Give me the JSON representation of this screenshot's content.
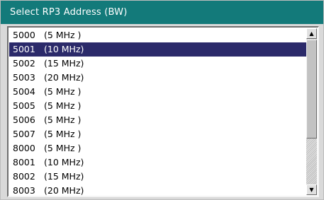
{
  "dialog": {
    "title": "Select RP3 Address  (BW)"
  },
  "list": {
    "items": [
      {
        "address": "5000",
        "bandwidth": "(5 MHz )"
      },
      {
        "address": "5001",
        "bandwidth": "(10 MHz)",
        "selected": true
      },
      {
        "address": "5002",
        "bandwidth": "(15 MHz)"
      },
      {
        "address": "5003",
        "bandwidth": "(20 MHz)"
      },
      {
        "address": "5004",
        "bandwidth": "(5 MHz )"
      },
      {
        "address": "5005",
        "bandwidth": "(5 MHz )"
      },
      {
        "address": "5006",
        "bandwidth": "(5 MHz )"
      },
      {
        "address": "5007",
        "bandwidth": "(5 MHz )"
      },
      {
        "address": "8000",
        "bandwidth": "(5 MHz )"
      },
      {
        "address": "8001",
        "bandwidth": "(10 MHz)"
      },
      {
        "address": "8002",
        "bandwidth": "(15 MHz)"
      },
      {
        "address": "8003",
        "bandwidth": "(20 MHz)"
      }
    ]
  },
  "scrollbar": {
    "up_icon": "▲",
    "down_icon": "▼"
  },
  "colors": {
    "title_bar": "#137a7a",
    "selection": "#2b2a6a"
  }
}
